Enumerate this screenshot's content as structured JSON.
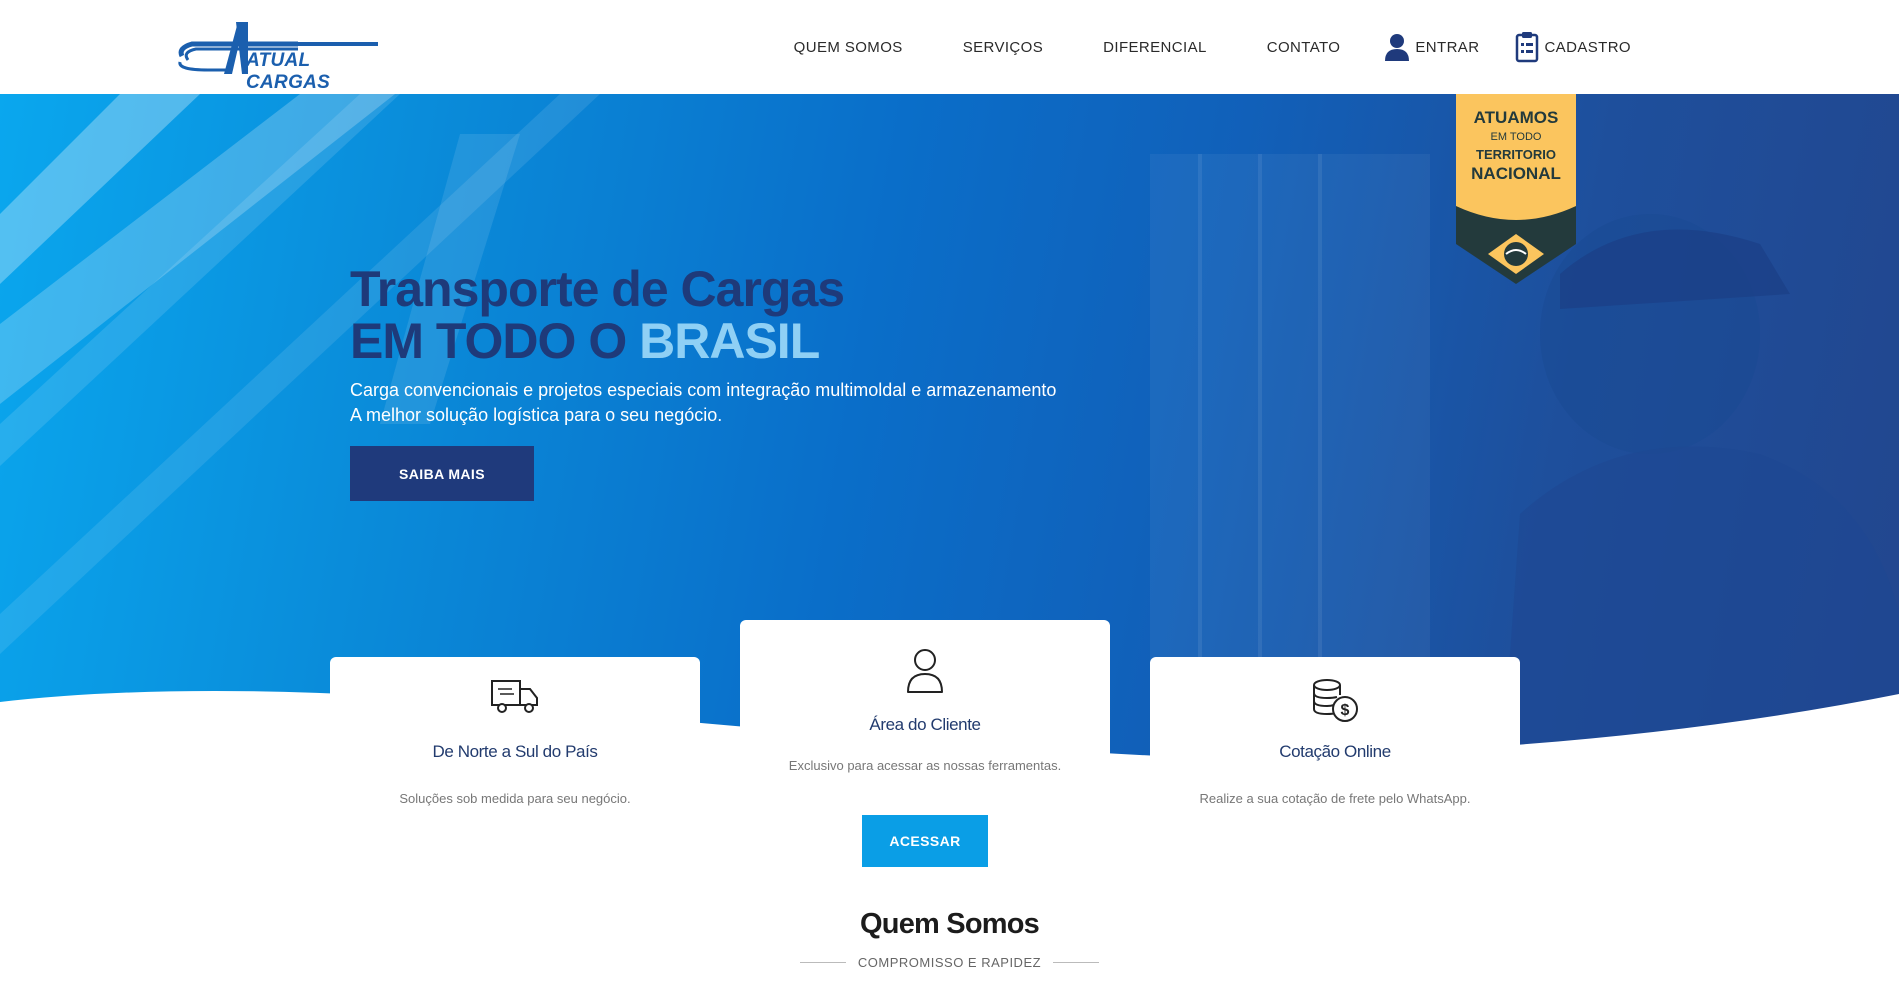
{
  "header": {
    "logo_text": "ATUAL CARGAS",
    "nav": [
      {
        "label": "QUEM SOMOS"
      },
      {
        "label": "SERVIÇOS"
      },
      {
        "label": "DIFERENCIAL"
      },
      {
        "label": "CONTATO"
      }
    ],
    "login_label": "ENTRAR",
    "signup_label": "CADASTRO"
  },
  "hero": {
    "title_line1": "Transporte de Cargas",
    "title_line2_dark": "EM TODO O",
    "title_line2_light": "BRASIL",
    "subtitle_line1": "Carga convencionais e projetos especiais com integração multimoldal e armazenamento",
    "subtitle_line2": "A melhor solução logística para o seu negócio.",
    "cta_label": "SAIBA MAIS",
    "badge": {
      "line1": "ATUAMOS",
      "line2": "EM TODO",
      "line3": "TERRITORIO",
      "line4": "NACIONAL"
    }
  },
  "cards": [
    {
      "title": "De Norte a Sul do País",
      "desc": "Soluções sob medida para seu negócio.",
      "icon": "truck-icon"
    },
    {
      "title": "Área do Cliente",
      "desc": "Exclusivo para acessar as nossas ferramentas.",
      "icon": "user-icon",
      "button": "ACESSAR"
    },
    {
      "title": "Cotação Online",
      "desc": "Realize a sua cotação de frete pelo WhatsApp.",
      "icon": "coins-dollar-icon"
    }
  ],
  "about": {
    "title": "Quem Somos",
    "subtitle": "COMPROMISSO E RAPIDEZ"
  },
  "colors": {
    "brand_dark": "#1f3a7c",
    "brand_light": "#0a9ee6",
    "badge_gold": "#fbc55e"
  }
}
